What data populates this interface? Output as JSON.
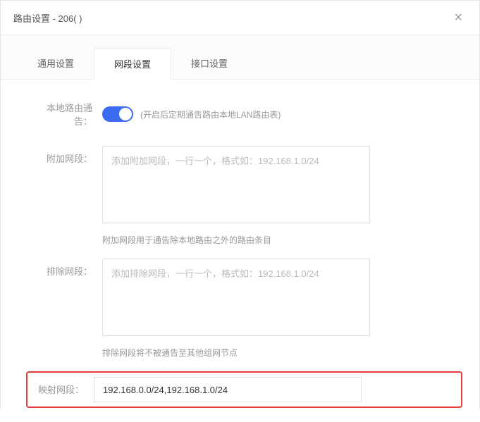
{
  "header": {
    "title": "路由设置 - 206(                                                          )"
  },
  "tabs": {
    "general": "通用设置",
    "network": "网段设置",
    "interface": "接口设置"
  },
  "form": {
    "localRouteAdvert": {
      "label": "本地路由通告：",
      "hint": "(开启后定期通告路由本地LAN路由表)"
    },
    "additionalSegment": {
      "label": "附加网段：",
      "placeholder": "添加附加网段，一行一个，格式如：192.168.1.0/24",
      "help": "附加网段用于通告除本地路由之外的路由条目"
    },
    "excludeSegment": {
      "label": "排除网段：",
      "placeholder": "添加排除网段，一行一个，格式如：192.168.1.0/24",
      "help": "排除网段将不被通告至其他组网节点"
    },
    "mappingSegment": {
      "label": "映射网段：",
      "value": "192.168.0.0/24,192.168.1.0/24"
    }
  }
}
